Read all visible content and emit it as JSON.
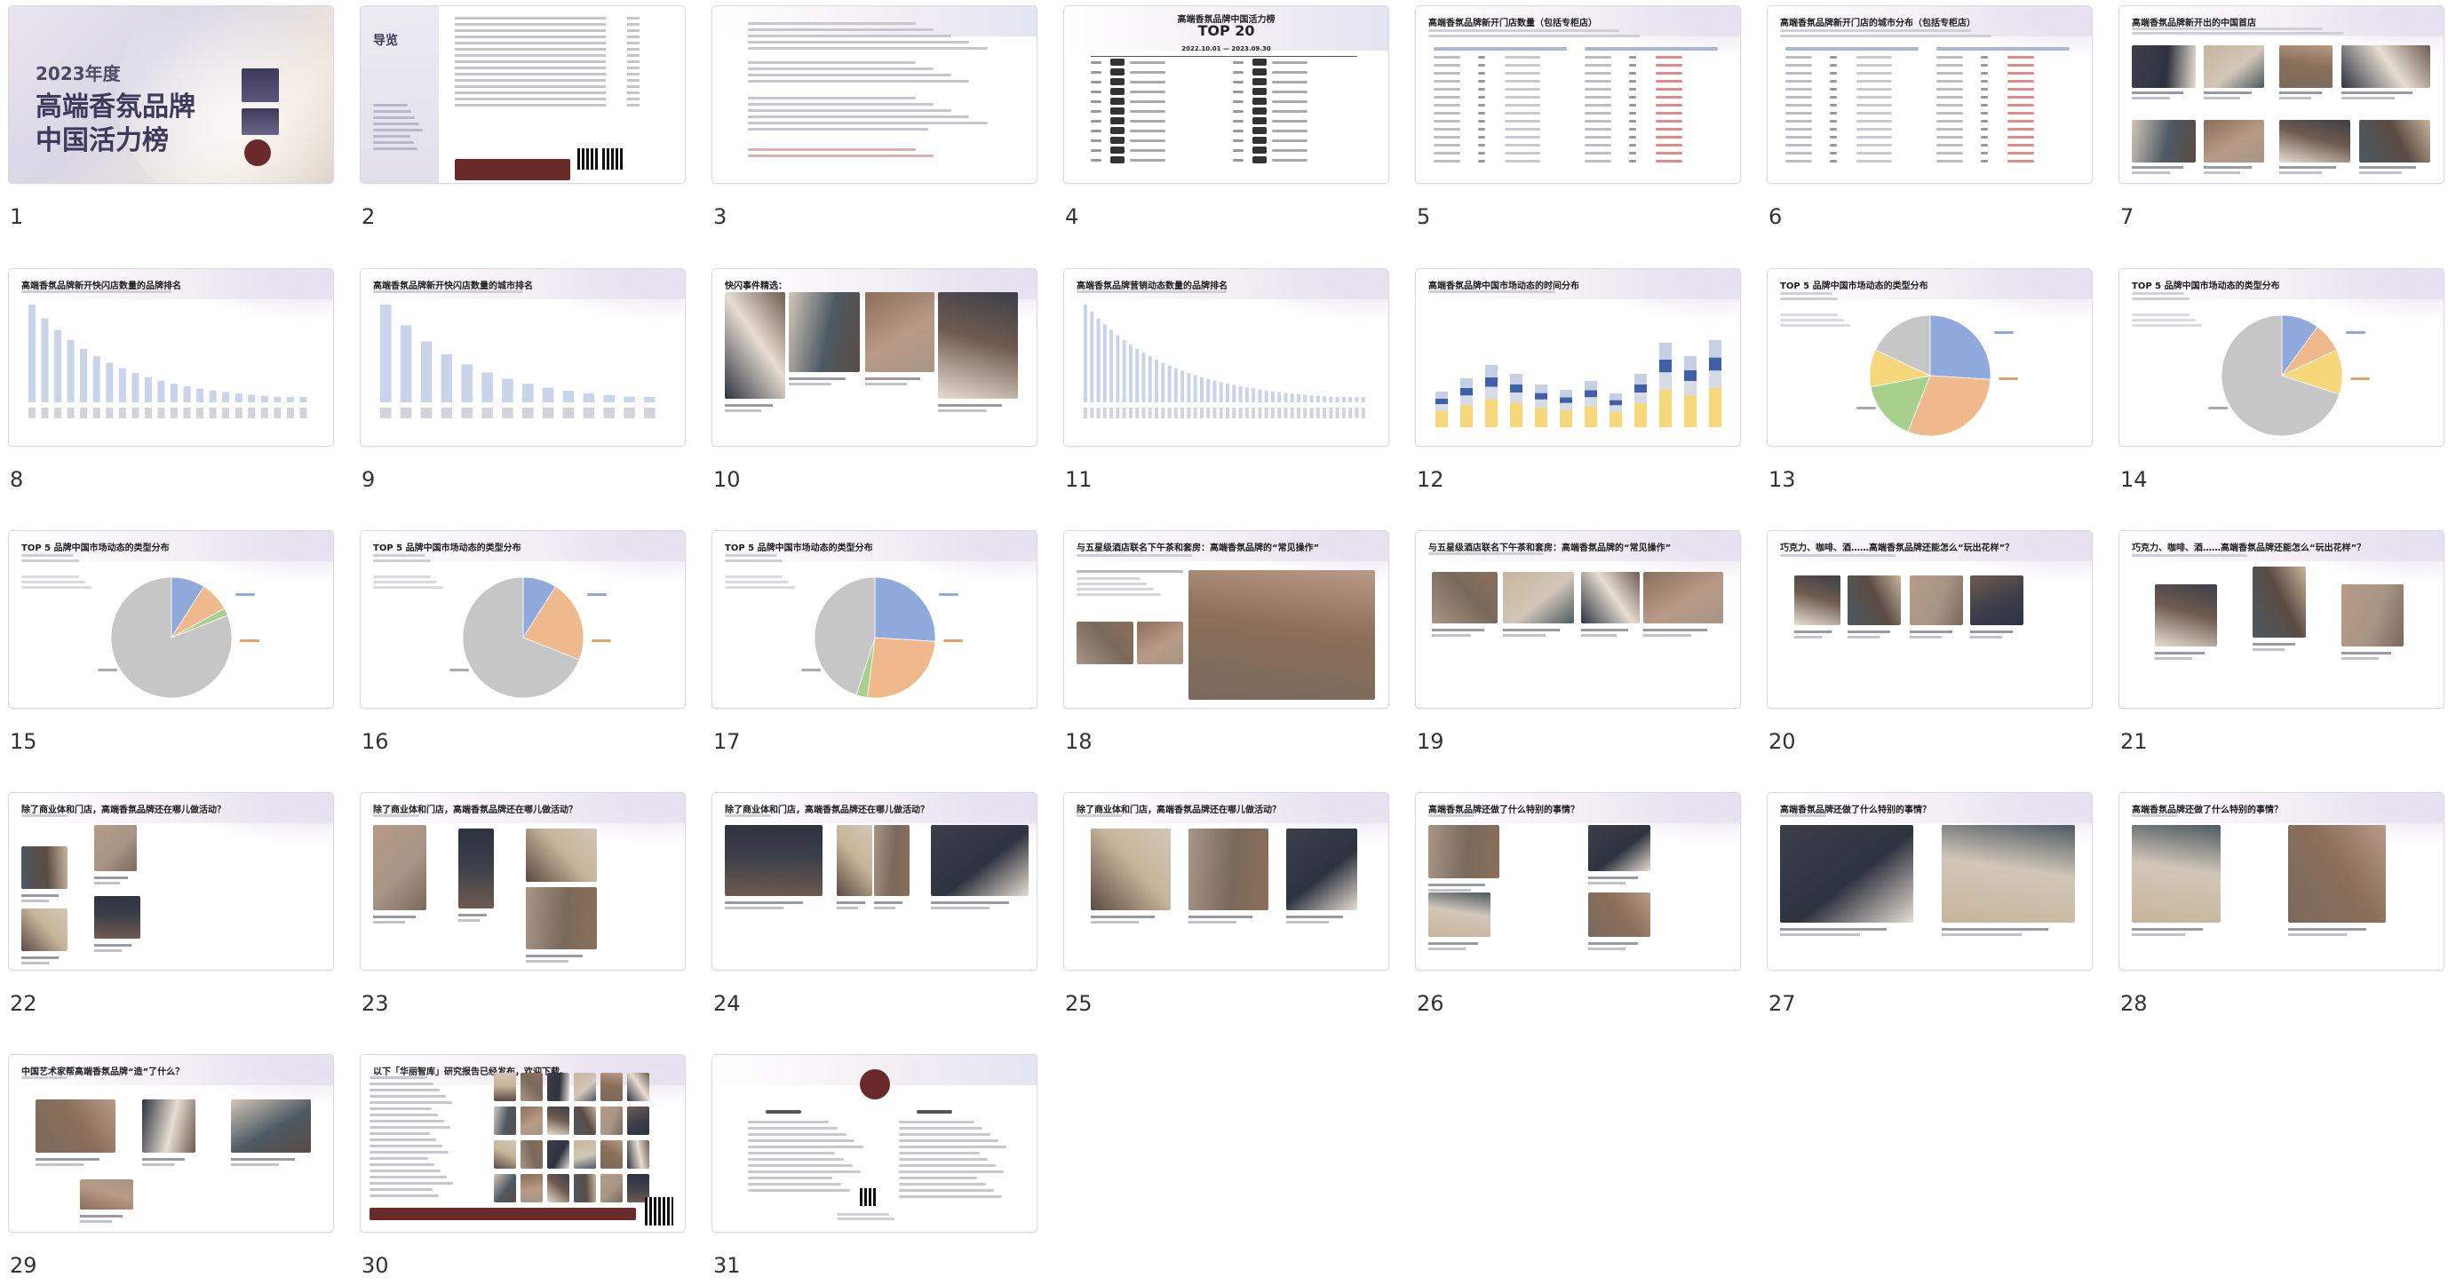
{
  "slides": [
    {
      "number": "1",
      "title": "高端香氛品牌中国活力榜",
      "title_line1": "高端香氛品牌",
      "title_line2": "中国活力榜",
      "year": "2023年度",
      "kind": "cover"
    },
    {
      "number": "2",
      "title": "导览",
      "kind": "toc"
    },
    {
      "number": "3",
      "title": "",
      "kind": "text"
    },
    {
      "number": "4",
      "title": "高端香氛品牌中国活力榜",
      "subtitle": "TOP 20",
      "period": "2022.10.01 — 2023.09.30",
      "kind": "top20"
    },
    {
      "number": "5",
      "title": "高端香氛品牌新开门店数量（包括专柜店）",
      "kind": "table"
    },
    {
      "number": "6",
      "title": "高端香氛品牌新开门店的城市分布（包括专柜店）",
      "kind": "table"
    },
    {
      "number": "7",
      "title": "高端香氛品牌新开出的中国首店",
      "kind": "photos"
    },
    {
      "number": "8",
      "title": "高端香氛品牌新开快闪店数量的品牌排名",
      "kind": "bars"
    },
    {
      "number": "9",
      "title": "高端香氛品牌新开快闪店数量的城市排名",
      "kind": "bars"
    },
    {
      "number": "10",
      "title": "快闪事件精选：",
      "kind": "photos"
    },
    {
      "number": "11",
      "title": "高端香氛品牌营销动态数量的品牌排名",
      "kind": "bars"
    },
    {
      "number": "12",
      "title": "高端香氛品牌中国市场动态的时间分布",
      "kind": "stacked"
    },
    {
      "number": "13",
      "title": "TOP 5 品牌中国市场动态的类型分布",
      "kind": "pie"
    },
    {
      "number": "14",
      "title": "TOP 5 品牌中国市场动态的类型分布",
      "kind": "pie"
    },
    {
      "number": "15",
      "title": "TOP 5 品牌中国市场动态的类型分布",
      "kind": "pie"
    },
    {
      "number": "16",
      "title": "TOP 5 品牌中国市场动态的类型分布",
      "kind": "pie"
    },
    {
      "number": "17",
      "title": "TOP 5 品牌中国市场动态的类型分布",
      "kind": "pie"
    },
    {
      "number": "18",
      "title": "与五星级酒店联名下午茶和套房：高端香氛品牌的“常见操作”",
      "kind": "photos"
    },
    {
      "number": "19",
      "title": "与五星级酒店联名下午茶和套房：高端香氛品牌的“常见操作”",
      "kind": "photos"
    },
    {
      "number": "20",
      "title": "巧克力、咖啡、酒……高端香氛品牌还能怎么“玩出花样”？",
      "kind": "photos"
    },
    {
      "number": "21",
      "title": "巧克力、咖啡、酒……高端香氛品牌还能怎么“玩出花样”？",
      "kind": "photos"
    },
    {
      "number": "22",
      "title": "除了商业体和门店，高端香氛品牌还在哪儿做活动？",
      "kind": "photos"
    },
    {
      "number": "23",
      "title": "除了商业体和门店，高端香氛品牌还在哪儿做活动？",
      "kind": "photos"
    },
    {
      "number": "24",
      "title": "除了商业体和门店，高端香氛品牌还在哪儿做活动？",
      "kind": "photos"
    },
    {
      "number": "25",
      "title": "除了商业体和门店，高端香氛品牌还在哪儿做活动？",
      "kind": "photos"
    },
    {
      "number": "26",
      "title": "高端香氛品牌还做了什么特别的事情？",
      "kind": "photos"
    },
    {
      "number": "27",
      "title": "高端香氛品牌还做了什么特别的事情？",
      "kind": "photos"
    },
    {
      "number": "28",
      "title": "高端香氛品牌还做了什么特别的事情？",
      "kind": "photos"
    },
    {
      "number": "29",
      "title": "中国艺术家帮高端香氛品牌“造”了什么？",
      "kind": "photos"
    },
    {
      "number": "30",
      "title": "以下「华丽智库」研究报告已经发布，欢迎下载。",
      "kind": "covers"
    },
    {
      "number": "31",
      "title": "",
      "kind": "about"
    }
  ],
  "colors": {
    "accent": "#3d3a5c",
    "seal": "#6b2a2a",
    "bar": "#c9d3ea",
    "pie_blue": "#8fa9dd",
    "pie_orange": "#f0b98c",
    "pie_yellow": "#f6d77a",
    "pie_green": "#a8d08d",
    "pie_grey": "#c6c6c6"
  }
}
